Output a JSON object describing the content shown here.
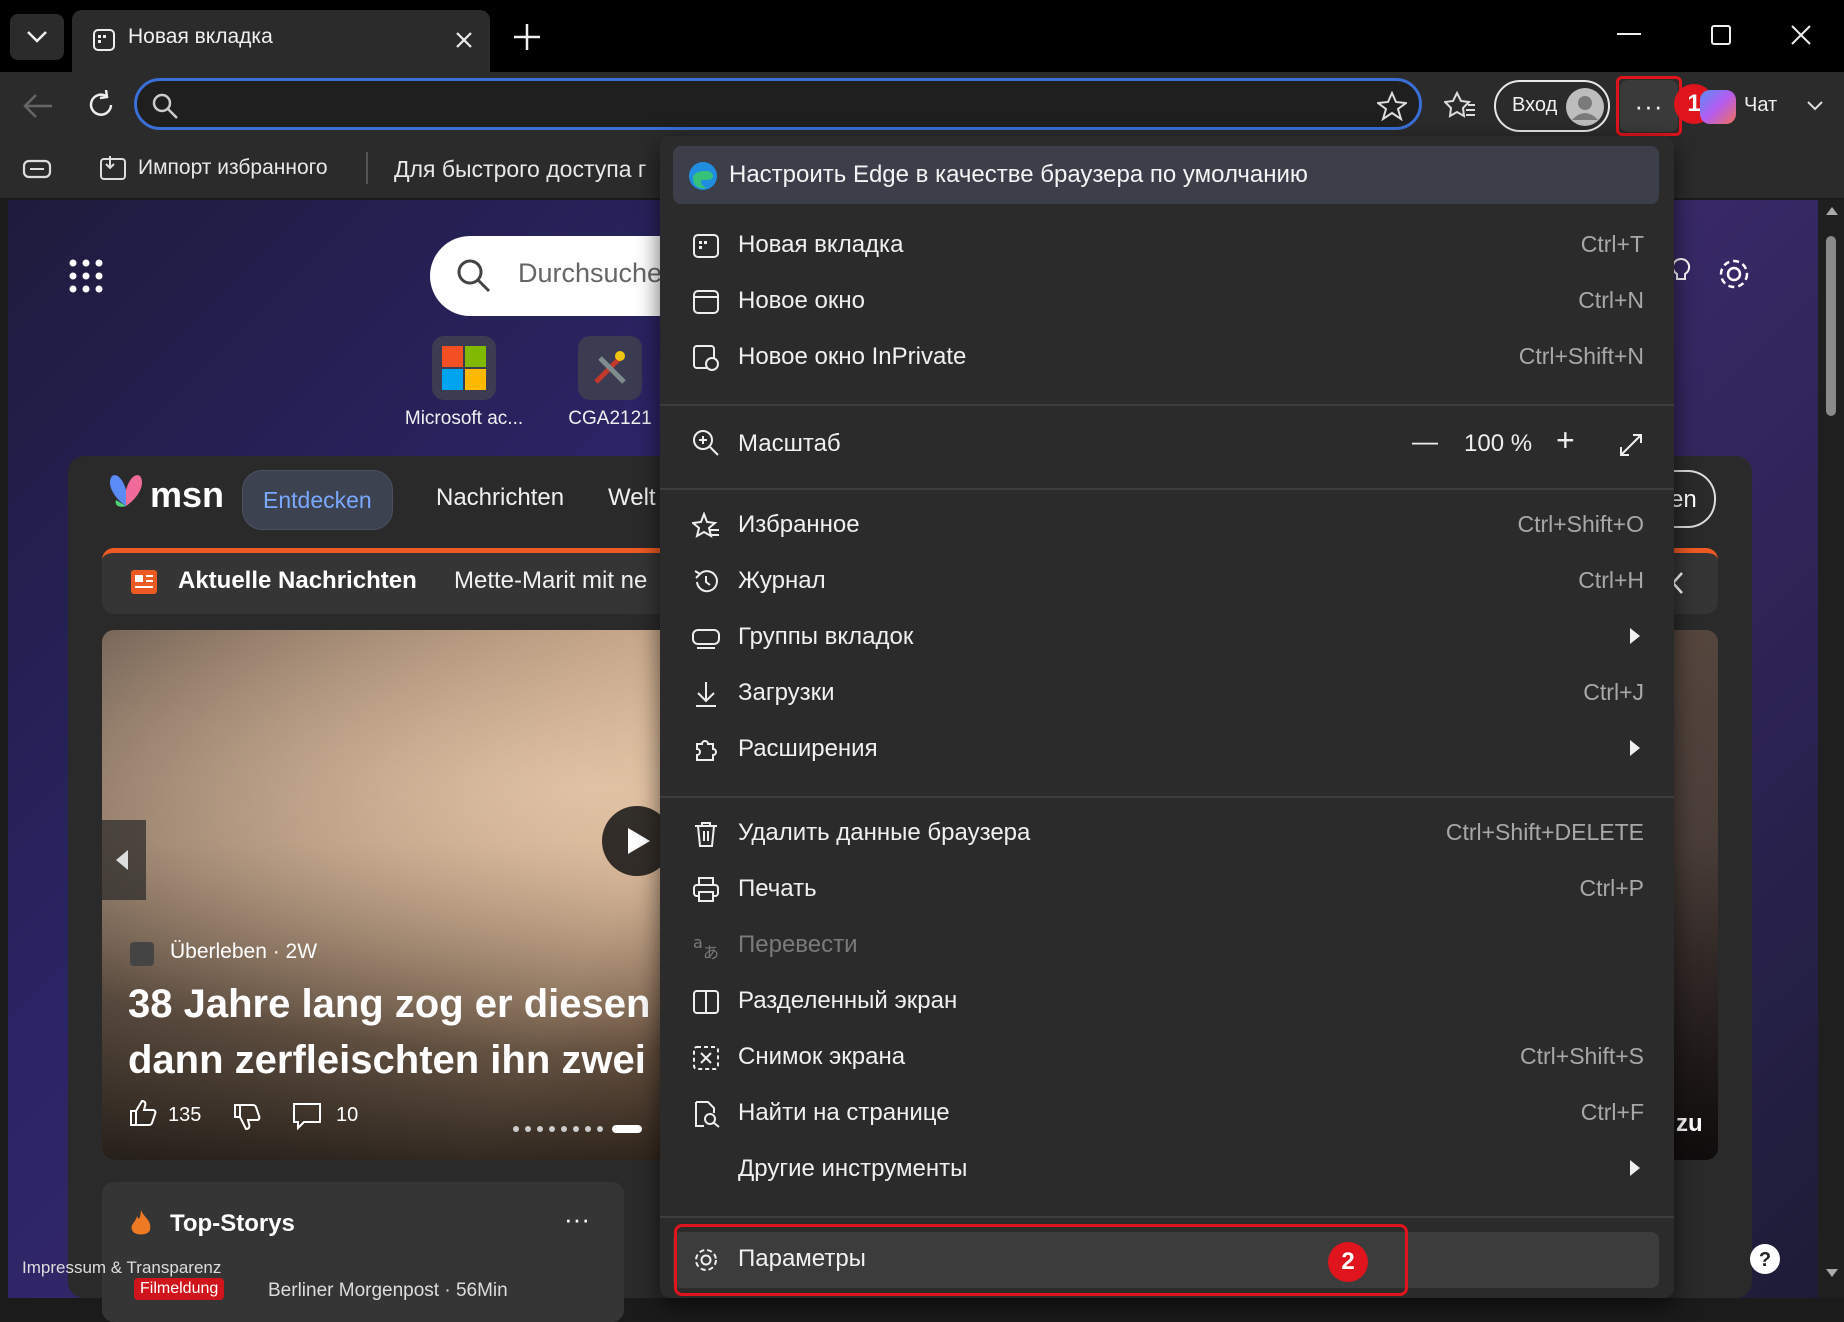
{
  "tab": {
    "title": "Новая вкладка"
  },
  "toolbar": {
    "address_value": "",
    "login_label": "Вход",
    "more_label": "···",
    "chat_label": "Чат"
  },
  "favorites_bar": {
    "import_label": "Импорт избранного",
    "hint": "Для быстрого доступа г"
  },
  "page": {
    "search_placeholder": "Durchsuche",
    "tiles": [
      {
        "label": "Microsoft ac..."
      },
      {
        "label": "CGA2121"
      }
    ],
    "msn": {
      "logo": "msn",
      "tabs": [
        "Entdecken",
        "Nachrichten",
        "Welt"
      ],
      "right_pill": "en",
      "news_label": "Aktuelle Nachrichten",
      "news_ticker": "Mette-Marit mit ne",
      "source": "Überleben · 2W",
      "headline_1": "38 Jahre lang zog er diesen",
      "headline_2": "dann zerfleischten ihn zwei",
      "likes": "135",
      "comments": "10",
      "side_text": "zu",
      "top_stories": "Top-Storys",
      "more": "···",
      "tag": "Filmeldung",
      "tag_source": "Berliner Morgenpost · 56Min",
      "footer": "Impressum & Transparenz"
    }
  },
  "menu": {
    "banner": "Настроить Edge в качестве браузера по умолчанию",
    "items": [
      {
        "label": "Новая вкладка",
        "shortcut": "Ctrl+T"
      },
      {
        "label": "Новое окно",
        "shortcut": "Ctrl+N"
      },
      {
        "label": "Новое окно InPrivate",
        "shortcut": "Ctrl+Shift+N"
      },
      {
        "label": "Масштаб",
        "shortcut": ""
      },
      {
        "label": "Избранное",
        "shortcut": "Ctrl+Shift+O"
      },
      {
        "label": "Журнал",
        "shortcut": "Ctrl+H"
      },
      {
        "label": "Группы вкладок",
        "shortcut": ""
      },
      {
        "label": "Загрузки",
        "shortcut": "Ctrl+J"
      },
      {
        "label": "Расширения",
        "shortcut": ""
      },
      {
        "label": "Удалить данные браузера",
        "shortcut": "Ctrl+Shift+DELETE"
      },
      {
        "label": "Печать",
        "shortcut": "Ctrl+P"
      },
      {
        "label": "Перевести",
        "shortcut": ""
      },
      {
        "label": "Разделенный экран",
        "shortcut": ""
      },
      {
        "label": "Снимок экрана",
        "shortcut": "Ctrl+Shift+S"
      },
      {
        "label": "Найти на странице",
        "shortcut": "Ctrl+F"
      },
      {
        "label": "Другие инструменты",
        "shortcut": ""
      },
      {
        "label": "Параметры",
        "shortcut": ""
      }
    ],
    "zoom": {
      "minus": "—",
      "value": "100 %",
      "plus": "+"
    }
  },
  "annotations": {
    "badge1": "1",
    "badge2": "2",
    "color": "#e0141c"
  },
  "colors": {
    "accent": "#3a6fd8",
    "menu_bg": "#2b2b2b",
    "news_bar": "#ee5a24"
  }
}
